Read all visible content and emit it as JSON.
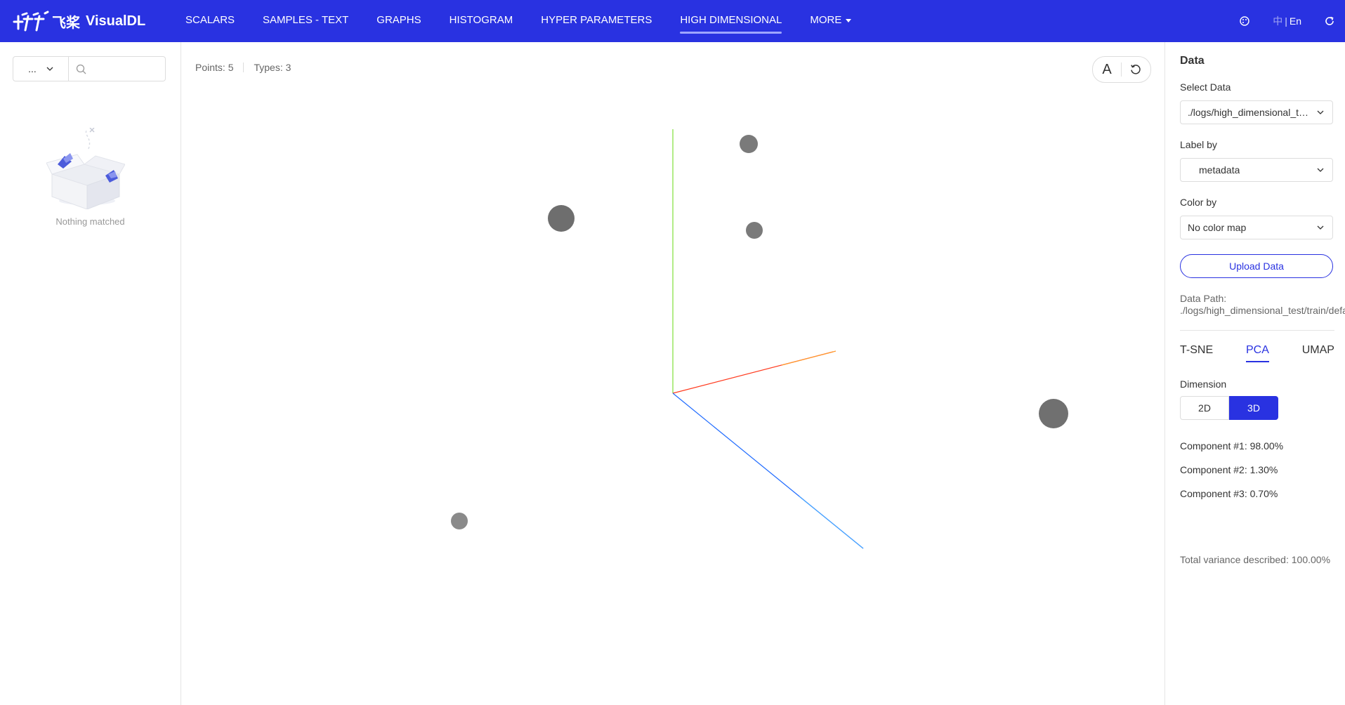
{
  "app": {
    "brand": "VisualDL",
    "brand_cn": "飞桨"
  },
  "nav": {
    "items": [
      {
        "label": "SCALARS"
      },
      {
        "label": "SAMPLES - TEXT"
      },
      {
        "label": "GRAPHS"
      },
      {
        "label": "HISTOGRAM"
      },
      {
        "label": "HYPER PARAMETERS"
      },
      {
        "label": "HIGH DIMENSIONAL",
        "active": true
      },
      {
        "label": "MORE"
      }
    ],
    "lang_zh": "中",
    "lang_en": "En",
    "icons": [
      "palette-icon",
      "refresh-icon"
    ]
  },
  "left": {
    "select_value": "...",
    "search_placeholder": "",
    "empty_text": "Nothing matched"
  },
  "canvas": {
    "points_text": "Points: 5",
    "types_text": "Types: 3",
    "label_toggle": "A"
  },
  "right": {
    "title": "Data",
    "select_data_label": "Select Data",
    "select_data_value": "./logs/high_dimensional_test/train/default",
    "label_by_label": "Label by",
    "label_by_value": "metadata",
    "color_by_label": "Color by",
    "color_by_value": "No color map",
    "upload_label": "Upload Data",
    "data_path_label": "Data Path:",
    "data_path_value": "./logs/high_dimensional_test/train/default",
    "algorithms": [
      "T-SNE",
      "PCA",
      "UMAP"
    ],
    "active_algorithm": "PCA",
    "dimension_label": "Dimension",
    "dimension_options": [
      "2D",
      "3D"
    ],
    "active_dimension": "3D",
    "components": [
      "Component #1: 98.00%",
      "Component #2: 1.30%",
      "Component #3: 0.70%"
    ],
    "total_variance": "Total variance described: 100.00%"
  },
  "colors": {
    "brand_blue": "#2932e1",
    "point_gray": "#7a7a7a",
    "axis_x": "#ff3b1f",
    "axis_y": "#7ee03a",
    "axis_z": "#1f6bff"
  }
}
